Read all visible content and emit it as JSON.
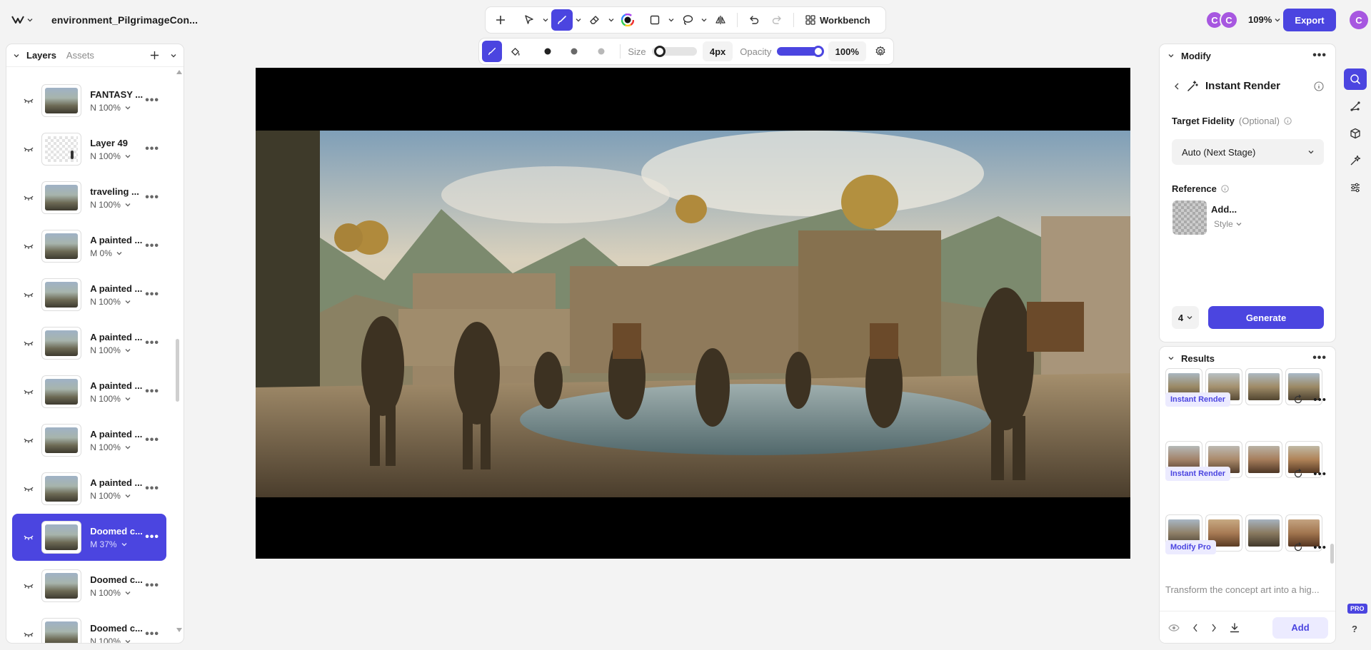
{
  "app": {
    "file_title": "environment_PilgrimageCon...",
    "zoom": "109%",
    "export_label": "Export",
    "user_initial": "C",
    "collaborators": [
      "C",
      "C"
    ],
    "accent_color": "#4b45e0"
  },
  "toolbar": {
    "workbench_label": "Workbench",
    "icons": [
      "plus-icon",
      "select-arrow-icon",
      "brush-icon",
      "eraser-icon",
      "color-wheel-icon",
      "rectangle-icon",
      "lasso-icon",
      "flip-icon",
      "undo-icon",
      "redo-icon",
      "workbench-icon"
    ]
  },
  "brush": {
    "size_label": "Size",
    "size_value": "4px",
    "opacity_label": "Opacity",
    "opacity_value": "100%",
    "size_level": 0.05,
    "opacity_level": 1.0
  },
  "layers_panel": {
    "tab_layers": "Layers",
    "tab_assets": "Assets",
    "layers": [
      {
        "name": "FANTASY ...",
        "mode": "N 100%",
        "thumb": "scene",
        "selected": false
      },
      {
        "name": "Layer 49",
        "mode": "N 100%",
        "thumb": "transparent",
        "selected": false
      },
      {
        "name": "traveling ...",
        "mode": "N 100%",
        "thumb": "scene",
        "selected": false
      },
      {
        "name": "A painted ...",
        "mode": "M 0%",
        "thumb": "scene",
        "selected": false
      },
      {
        "name": "A painted ...",
        "mode": "N 100%",
        "thumb": "scene",
        "selected": false
      },
      {
        "name": "A painted ...",
        "mode": "N 100%",
        "thumb": "scene",
        "selected": false
      },
      {
        "name": "A painted ...",
        "mode": "N 100%",
        "thumb": "scene",
        "selected": false
      },
      {
        "name": "A painted ...",
        "mode": "N 100%",
        "thumb": "scene",
        "selected": false
      },
      {
        "name": "A painted ...",
        "mode": "N 100%",
        "thumb": "scene",
        "selected": false
      },
      {
        "name": "Doomed c...",
        "mode": "M 37%",
        "thumb": "scene",
        "selected": true
      },
      {
        "name": "Doomed c...",
        "mode": "N 100%",
        "thumb": "scene",
        "selected": false
      },
      {
        "name": "Doomed c...",
        "mode": "N 100%",
        "thumb": "scene",
        "selected": false
      }
    ]
  },
  "modify": {
    "header": "Modify",
    "tool_title": "Instant Render",
    "target_fidelity_label": "Target Fidelity",
    "target_fidelity_optional": "(Optional)",
    "target_fidelity_value": "Auto (Next Stage)",
    "reference_label": "Reference",
    "reference_add": "Add...",
    "reference_style": "Style",
    "count_value": "4",
    "generate_label": "Generate"
  },
  "results": {
    "header": "Results",
    "groups": [
      {
        "tag": "Instant Render"
      },
      {
        "tag": "Instant Render"
      },
      {
        "tag": "Modify Pro"
      }
    ],
    "description": "Transform the concept art into a hig...",
    "add_label": "Add"
  },
  "right_rail": {
    "icons": [
      "generate-icon",
      "share-nodes-icon",
      "cube-icon",
      "sparkle-brush-icon",
      "sliders-icon"
    ],
    "pro_badge": "PRO",
    "help": "?"
  }
}
